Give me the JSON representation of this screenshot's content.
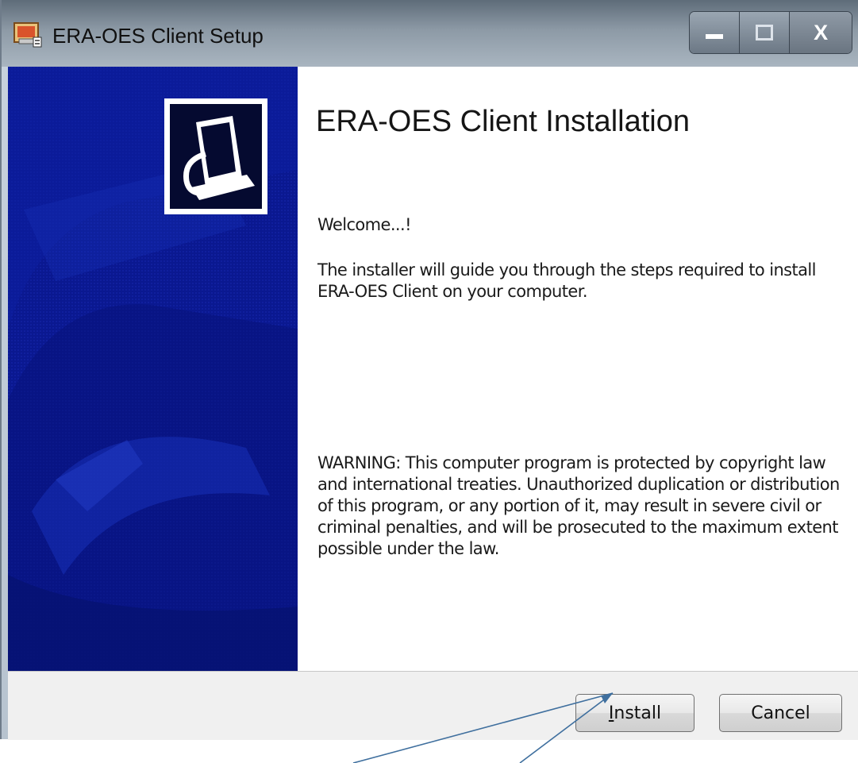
{
  "window": {
    "title": "ERA-OES Client Setup"
  },
  "caption_buttons": {
    "close_label": "X"
  },
  "content": {
    "heading": "ERA-OES Client Installation",
    "welcome": "Welcome...!",
    "intro": "The installer will guide you through the steps required to install ERA-OES Client on your computer.",
    "warning": "WARNING: This computer program is protected by copyright law and international treaties. Unauthorized duplication or distribution of this program, or any portion of it, may result in severe civil or criminal penalties, and will be prosecuted to the maximum extent possible under the law."
  },
  "buttons": {
    "install_mnemonic": "I",
    "install_rest": "nstall",
    "cancel": "Cancel"
  },
  "colors": {
    "banner": "#0a1890",
    "annotation_arrow": "#3f6f9e"
  }
}
